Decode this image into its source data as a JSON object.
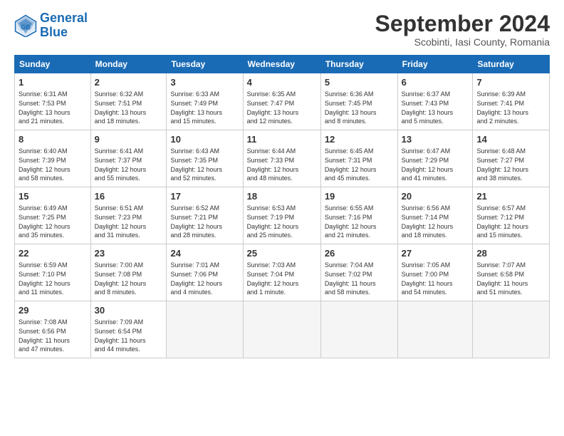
{
  "header": {
    "logo_line1": "General",
    "logo_line2": "Blue",
    "month": "September 2024",
    "location": "Scobinti, Iasi County, Romania"
  },
  "days_of_week": [
    "Sunday",
    "Monday",
    "Tuesday",
    "Wednesday",
    "Thursday",
    "Friday",
    "Saturday"
  ],
  "weeks": [
    [
      {
        "day": "1",
        "lines": [
          "Sunrise: 6:31 AM",
          "Sunset: 7:53 PM",
          "Daylight: 13 hours",
          "and 21 minutes."
        ]
      },
      {
        "day": "2",
        "lines": [
          "Sunrise: 6:32 AM",
          "Sunset: 7:51 PM",
          "Daylight: 13 hours",
          "and 18 minutes."
        ]
      },
      {
        "day": "3",
        "lines": [
          "Sunrise: 6:33 AM",
          "Sunset: 7:49 PM",
          "Daylight: 13 hours",
          "and 15 minutes."
        ]
      },
      {
        "day": "4",
        "lines": [
          "Sunrise: 6:35 AM",
          "Sunset: 7:47 PM",
          "Daylight: 13 hours",
          "and 12 minutes."
        ]
      },
      {
        "day": "5",
        "lines": [
          "Sunrise: 6:36 AM",
          "Sunset: 7:45 PM",
          "Daylight: 13 hours",
          "and 8 minutes."
        ]
      },
      {
        "day": "6",
        "lines": [
          "Sunrise: 6:37 AM",
          "Sunset: 7:43 PM",
          "Daylight: 13 hours",
          "and 5 minutes."
        ]
      },
      {
        "day": "7",
        "lines": [
          "Sunrise: 6:39 AM",
          "Sunset: 7:41 PM",
          "Daylight: 13 hours",
          "and 2 minutes."
        ]
      }
    ],
    [
      {
        "day": "8",
        "lines": [
          "Sunrise: 6:40 AM",
          "Sunset: 7:39 PM",
          "Daylight: 12 hours",
          "and 58 minutes."
        ]
      },
      {
        "day": "9",
        "lines": [
          "Sunrise: 6:41 AM",
          "Sunset: 7:37 PM",
          "Daylight: 12 hours",
          "and 55 minutes."
        ]
      },
      {
        "day": "10",
        "lines": [
          "Sunrise: 6:43 AM",
          "Sunset: 7:35 PM",
          "Daylight: 12 hours",
          "and 52 minutes."
        ]
      },
      {
        "day": "11",
        "lines": [
          "Sunrise: 6:44 AM",
          "Sunset: 7:33 PM",
          "Daylight: 12 hours",
          "and 48 minutes."
        ]
      },
      {
        "day": "12",
        "lines": [
          "Sunrise: 6:45 AM",
          "Sunset: 7:31 PM",
          "Daylight: 12 hours",
          "and 45 minutes."
        ]
      },
      {
        "day": "13",
        "lines": [
          "Sunrise: 6:47 AM",
          "Sunset: 7:29 PM",
          "Daylight: 12 hours",
          "and 41 minutes."
        ]
      },
      {
        "day": "14",
        "lines": [
          "Sunrise: 6:48 AM",
          "Sunset: 7:27 PM",
          "Daylight: 12 hours",
          "and 38 minutes."
        ]
      }
    ],
    [
      {
        "day": "15",
        "lines": [
          "Sunrise: 6:49 AM",
          "Sunset: 7:25 PM",
          "Daylight: 12 hours",
          "and 35 minutes."
        ]
      },
      {
        "day": "16",
        "lines": [
          "Sunrise: 6:51 AM",
          "Sunset: 7:23 PM",
          "Daylight: 12 hours",
          "and 31 minutes."
        ]
      },
      {
        "day": "17",
        "lines": [
          "Sunrise: 6:52 AM",
          "Sunset: 7:21 PM",
          "Daylight: 12 hours",
          "and 28 minutes."
        ]
      },
      {
        "day": "18",
        "lines": [
          "Sunrise: 6:53 AM",
          "Sunset: 7:19 PM",
          "Daylight: 12 hours",
          "and 25 minutes."
        ]
      },
      {
        "day": "19",
        "lines": [
          "Sunrise: 6:55 AM",
          "Sunset: 7:16 PM",
          "Daylight: 12 hours",
          "and 21 minutes."
        ]
      },
      {
        "day": "20",
        "lines": [
          "Sunrise: 6:56 AM",
          "Sunset: 7:14 PM",
          "Daylight: 12 hours",
          "and 18 minutes."
        ]
      },
      {
        "day": "21",
        "lines": [
          "Sunrise: 6:57 AM",
          "Sunset: 7:12 PM",
          "Daylight: 12 hours",
          "and 15 minutes."
        ]
      }
    ],
    [
      {
        "day": "22",
        "lines": [
          "Sunrise: 6:59 AM",
          "Sunset: 7:10 PM",
          "Daylight: 12 hours",
          "and 11 minutes."
        ]
      },
      {
        "day": "23",
        "lines": [
          "Sunrise: 7:00 AM",
          "Sunset: 7:08 PM",
          "Daylight: 12 hours",
          "and 8 minutes."
        ]
      },
      {
        "day": "24",
        "lines": [
          "Sunrise: 7:01 AM",
          "Sunset: 7:06 PM",
          "Daylight: 12 hours",
          "and 4 minutes."
        ]
      },
      {
        "day": "25",
        "lines": [
          "Sunrise: 7:03 AM",
          "Sunset: 7:04 PM",
          "Daylight: 12 hours",
          "and 1 minute."
        ]
      },
      {
        "day": "26",
        "lines": [
          "Sunrise: 7:04 AM",
          "Sunset: 7:02 PM",
          "Daylight: 11 hours",
          "and 58 minutes."
        ]
      },
      {
        "day": "27",
        "lines": [
          "Sunrise: 7:05 AM",
          "Sunset: 7:00 PM",
          "Daylight: 11 hours",
          "and 54 minutes."
        ]
      },
      {
        "day": "28",
        "lines": [
          "Sunrise: 7:07 AM",
          "Sunset: 6:58 PM",
          "Daylight: 11 hours",
          "and 51 minutes."
        ]
      }
    ],
    [
      {
        "day": "29",
        "lines": [
          "Sunrise: 7:08 AM",
          "Sunset: 6:56 PM",
          "Daylight: 11 hours",
          "and 47 minutes."
        ]
      },
      {
        "day": "30",
        "lines": [
          "Sunrise: 7:09 AM",
          "Sunset: 6:54 PM",
          "Daylight: 11 hours",
          "and 44 minutes."
        ]
      },
      {
        "day": "",
        "lines": [],
        "empty": true
      },
      {
        "day": "",
        "lines": [],
        "empty": true
      },
      {
        "day": "",
        "lines": [],
        "empty": true
      },
      {
        "day": "",
        "lines": [],
        "empty": true
      },
      {
        "day": "",
        "lines": [],
        "empty": true
      }
    ]
  ]
}
